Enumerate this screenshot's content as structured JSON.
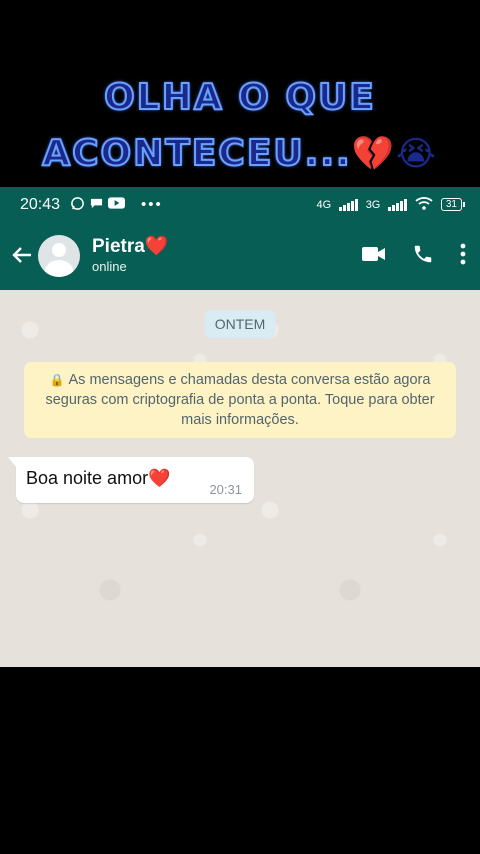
{
  "caption": {
    "line1": "OLHA O QUE",
    "line2": "ACONTECEU...",
    "emoji_broken_heart": "💔",
    "emoji_crying": "😭"
  },
  "statusbar": {
    "time": "20:43",
    "network1": "4G",
    "network2": "3G",
    "battery": "31"
  },
  "contact": {
    "name": "Pietra",
    "name_emoji": "❤️",
    "status": "online"
  },
  "chat": {
    "date_chip": "ONTEM",
    "encryption_notice": "As mensagens e chamadas desta conversa estão agora seguras com criptografia de ponta a ponta. Toque para obter mais informações.",
    "messages": [
      {
        "text": "Boa noite amor",
        "emoji": "❤️",
        "time": "20:31"
      }
    ]
  },
  "colors": {
    "header_green": "#075e54",
    "chat_background": "#e6e1da",
    "notice_yellow": "#fdf3c5",
    "date_chip_blue": "#d9ecf4"
  },
  "icons": [
    "whatsapp-icon",
    "chat-bubble-icon",
    "youtube-icon",
    "more-dots-icon",
    "signal-icon",
    "wifi-icon",
    "battery-icon",
    "back-arrow-icon",
    "video-call-icon",
    "phone-call-icon",
    "menu-kebab-icon",
    "lock-icon"
  ]
}
